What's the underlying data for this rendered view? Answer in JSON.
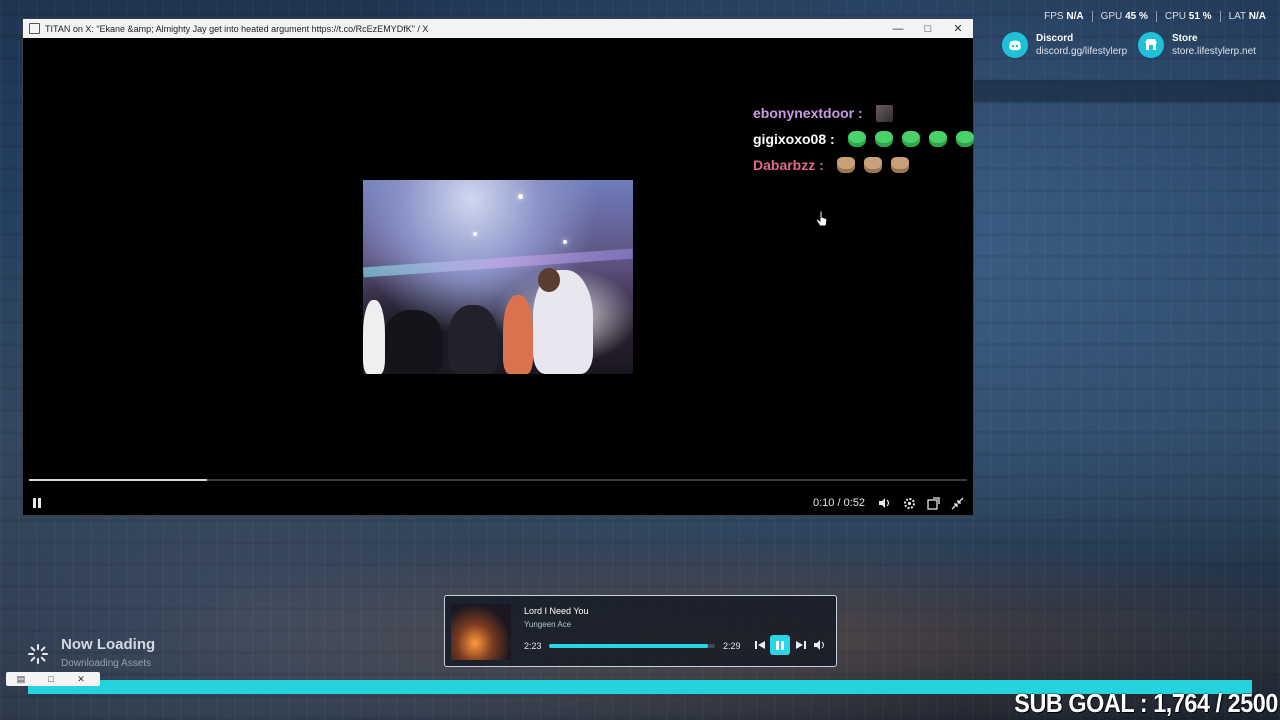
{
  "window": {
    "title": "TITAN on X: \"Ekane &amp; Almighty Jay get into heated argument https://t.co/RcEzEMYDfK\" / X",
    "minimize_icon": "minimize-icon",
    "maximize_icon": "maximize-icon",
    "close_icon": "close-icon"
  },
  "chat": [
    {
      "user": "ebonynextdoor :",
      "color": "#c89be6",
      "emotes": [
        "photo"
      ]
    },
    {
      "user": "gigixoxo08 :",
      "color": "#ffffff",
      "emotes": [
        "green",
        "green",
        "green",
        "green",
        "green"
      ]
    },
    {
      "user": "Dabarbzz :",
      "color": "#e06a8a",
      "emotes": [
        "cat",
        "cat",
        "cat"
      ]
    }
  ],
  "player": {
    "progress": 0.19,
    "time": "0:10 / 0:52",
    "icons": [
      "pause-icon",
      "volume-icon",
      "settings-icon",
      "popout-icon",
      "exit-fullscreen-icon"
    ]
  },
  "hud": {
    "fps_label": "FPS",
    "fps_value": "N/A",
    "gpu_label": "GPU",
    "gpu_value": "45 %",
    "cpu_label": "CPU",
    "cpu_value": "51 %",
    "lat_label": "LAT",
    "lat_value": "N/A",
    "discord_title": "Discord",
    "discord_sub": "discord.gg/lifestylerp",
    "store_title": "Store",
    "store_sub": "store.lifestylerp.net",
    "accent": "#1fc1d8"
  },
  "music": {
    "track": "Lord I Need You",
    "artist": "Yungeen Ace",
    "elapsed": "2:23",
    "duration": "2:29",
    "progress": 0.96
  },
  "loading": {
    "title": "Now Loading",
    "subtitle": "Downloading Assets"
  },
  "sub_goal": {
    "text": "SUB GOAL : 1,764 / 2500",
    "bar_color": "#25d3de"
  }
}
